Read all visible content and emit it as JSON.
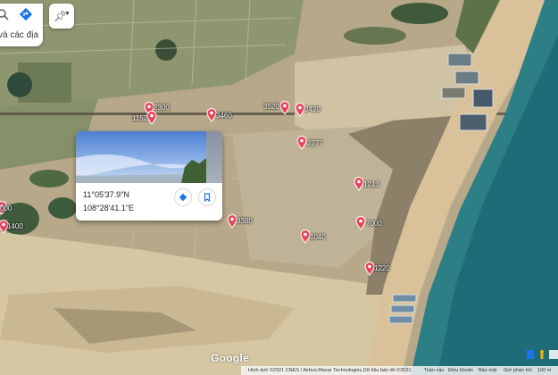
{
  "search": {
    "subtitle": "và các địa"
  },
  "icons": {
    "search": "search-icon",
    "directions": "directions-icon",
    "layers": "pushpin-layer-icon",
    "caret": "caret-down-icon",
    "save": "bookmark-icon",
    "route": "directions-icon",
    "person": "pegman-icon",
    "imagery": "imagery-toggle-icon"
  },
  "markers": [
    {
      "label": "2300"
    },
    {
      "label": "1152"
    },
    {
      "label": "3460"
    },
    {
      "label": "3520"
    },
    {
      "label": "2420"
    },
    {
      "label": "2277"
    },
    {
      "label": "1213"
    },
    {
      "label": "3380"
    },
    {
      "label": "7000"
    },
    {
      "label": "1040"
    },
    {
      "label": "1220"
    },
    {
      "label": "000"
    },
    {
      "label": "1400"
    }
  ],
  "info_card": {
    "latitude": "11°05'37.9\"N",
    "longitude": "108°28'41.1\"E"
  },
  "logo": "Google",
  "footer": {
    "imagery": "Hình ảnh ©2021 CNES / Airbus,Maxar Technologies,Dữ liệu bản đồ ©2021",
    "global": "Toàn cầu",
    "terms": "Điều khoản",
    "privacy": "Bảo mật",
    "feedback": "Gửi phản hồi",
    "scale": "100 m"
  },
  "colors": {
    "sea": "#2d7f86",
    "beach": "#d9c29a",
    "marker": "#e8455b",
    "accent": "#1a73e8"
  }
}
